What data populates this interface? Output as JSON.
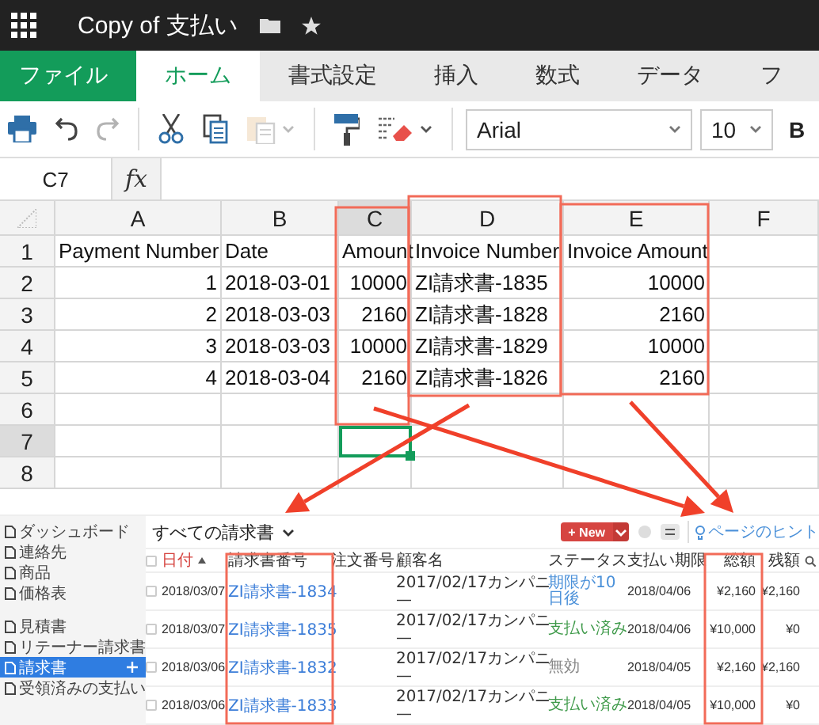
{
  "title_bar": {
    "title": "Copy of 支払い"
  },
  "ribbon_tabs": [
    {
      "label": "ファイル",
      "kind": "menu",
      "selected": false
    },
    {
      "label": "ホーム",
      "kind": "tab",
      "selected": true
    },
    {
      "label": "書式設定",
      "kind": "tab",
      "selected": false
    },
    {
      "label": "挿入",
      "kind": "tab",
      "selected": false
    },
    {
      "label": "数式",
      "kind": "tab",
      "selected": false
    },
    {
      "label": "データ",
      "kind": "tab",
      "selected": false
    },
    {
      "label": "フ",
      "kind": "tab",
      "selected": false
    }
  ],
  "toolbar": {
    "groups": [
      [
        {
          "kind": "print",
          "disabled": false
        },
        {
          "kind": "undo",
          "disabled": false
        },
        {
          "kind": "redo",
          "disabled": true
        }
      ],
      [
        {
          "kind": "cut",
          "disabled": false
        },
        {
          "kind": "copy",
          "disabled": false
        },
        {
          "kind": "paste",
          "disabled": true
        }
      ],
      [
        {
          "kind": "format-painter",
          "disabled": false
        },
        {
          "kind": "clear-format",
          "disabled": false
        }
      ]
    ],
    "font": "Arial",
    "font_size": "10",
    "bold": "B"
  },
  "formula_bar": {
    "cell": "C7",
    "function_label": "fx"
  },
  "sheet": {
    "columns": [
      {
        "label": "A",
        "selected": false
      },
      {
        "label": "B",
        "selected": false
      },
      {
        "label": "C",
        "selected": true
      },
      {
        "label": "D",
        "selected": false
      },
      {
        "label": "E",
        "selected": false
      },
      {
        "label": "F",
        "selected": false
      }
    ],
    "rows": [
      {
        "label": "1",
        "selected": false,
        "cells": [
          {
            "text": "Payment Number",
            "right_aligned": false
          },
          {
            "text": "Date",
            "right_aligned": false
          },
          {
            "text": "Amount",
            "right_aligned": false
          },
          {
            "text": "Invoice Number",
            "right_aligned": false
          },
          {
            "text": "Invoice Amount",
            "right_aligned": false
          },
          null
        ]
      },
      {
        "label": "2",
        "selected": false,
        "cells": [
          {
            "text": "1",
            "right_aligned": true
          },
          {
            "text": "2018-03-01",
            "right_aligned": false
          },
          {
            "text": "10000",
            "right_aligned": true
          },
          {
            "text": "ZI請求書-1835",
            "right_aligned": false
          },
          {
            "text": "10000",
            "right_aligned": true
          },
          null
        ]
      },
      {
        "label": "3",
        "selected": false,
        "cells": [
          {
            "text": "2",
            "right_aligned": true
          },
          {
            "text": "2018-03-03",
            "right_aligned": false
          },
          {
            "text": "2160",
            "right_aligned": true
          },
          {
            "text": "ZI請求書-1828",
            "right_aligned": false
          },
          {
            "text": "2160",
            "right_aligned": true
          },
          null
        ]
      },
      {
        "label": "4",
        "selected": false,
        "cells": [
          {
            "text": "3",
            "right_aligned": true
          },
          {
            "text": "2018-03-03",
            "right_aligned": false
          },
          {
            "text": "10000",
            "right_aligned": true
          },
          {
            "text": "ZI請求書-1829",
            "right_aligned": false
          },
          {
            "text": "10000",
            "right_aligned": true
          },
          null
        ]
      },
      {
        "label": "5",
        "selected": false,
        "cells": [
          {
            "text": "4",
            "right_aligned": true
          },
          {
            "text": "2018-03-04",
            "right_aligned": false
          },
          {
            "text": "2160",
            "right_aligned": true
          },
          {
            "text": "ZI請求書-1826",
            "right_aligned": false
          },
          {
            "text": "2160",
            "right_aligned": true
          },
          null
        ]
      },
      {
        "label": "6",
        "selected": false,
        "cells": [
          null,
          null,
          null,
          null,
          null,
          null
        ]
      },
      {
        "label": "7",
        "selected": true,
        "cells": [
          null,
          null,
          null,
          null,
          null,
          null
        ]
      },
      {
        "label": "8",
        "selected": false,
        "cells": [
          null,
          null,
          null,
          null,
          null,
          null
        ]
      }
    ]
  },
  "invoices": {
    "sidebar_groups": [
      {
        "items": [
          {
            "label": "ダッシュボード",
            "selected": false
          },
          {
            "label": "連絡先",
            "selected": false
          },
          {
            "label": "商品",
            "selected": false
          },
          {
            "label": "価格表",
            "selected": false
          }
        ]
      },
      {
        "items": [
          {
            "label": "見積書",
            "selected": false
          },
          {
            "label": "リテーナー請求書",
            "selected": false
          },
          {
            "label": "請求書",
            "selected": true
          },
          {
            "label": "受領済みの支払い",
            "selected": false
          }
        ]
      }
    ],
    "title": "すべての請求書",
    "new_button": "+ New",
    "hint": "ページのヒント",
    "select_all_checked": false,
    "columns": [
      {
        "label": "日付",
        "sorted": true
      },
      {
        "label": "請求書番号",
        "sorted": false
      },
      {
        "label": "注文番号",
        "sorted": false
      },
      {
        "label": "顧客名",
        "sorted": false
      },
      {
        "label": "ステータス",
        "sorted": false
      },
      {
        "label": "支払い期限",
        "sorted": false
      },
      {
        "label": "総額",
        "sorted": false
      },
      {
        "label": "残額",
        "sorted": false
      }
    ],
    "rows": [
      {
        "checked": false,
        "date": "2018/03/07",
        "invoice_number": "ZI請求書-1834",
        "customer": "2017/02/17カンパニ",
        "customer_note": "—",
        "status": "期限が10日後",
        "color": "#4a90d9",
        "due_date": "2018/04/06",
        "total": "¥2,160",
        "balance": "¥2,160"
      },
      {
        "checked": false,
        "date": "2018/03/07",
        "invoice_number": "ZI請求書-1835",
        "customer": "2017/02/17カンパニ",
        "customer_note": "—",
        "status": "支払い済み",
        "color": "#3f9a4a",
        "due_date": "2018/04/06",
        "total": "¥10,000",
        "balance": "¥0"
      },
      {
        "checked": false,
        "date": "2018/03/06",
        "invoice_number": "ZI請求書-1832",
        "customer": "2017/02/17カンパニ",
        "customer_note": "—",
        "status": "無効",
        "color": "#888888",
        "due_date": "2018/04/05",
        "total": "¥2,160",
        "balance": "¥2,160"
      },
      {
        "checked": false,
        "date": "2018/03/06",
        "invoice_number": "ZI請求書-1833",
        "customer": "2017/02/17カンパニ",
        "customer_note": "—",
        "status": "支払い済み",
        "color": "#3f9a4a",
        "due_date": "2018/04/05",
        "total": "¥10,000",
        "balance": "¥0"
      }
    ]
  }
}
